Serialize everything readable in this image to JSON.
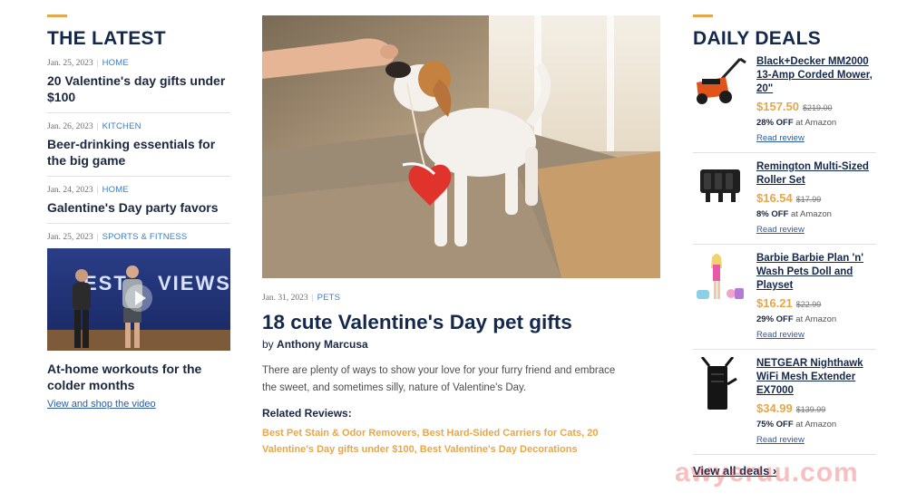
{
  "left": {
    "section_title": "THE LATEST",
    "stories": [
      {
        "date": "Jan. 25, 2023",
        "category": "HOME",
        "title": "20 Valentine's day gifts under $100"
      },
      {
        "date": "Jan. 26, 2023",
        "category": "KITCHEN",
        "title": "Beer-drinking essentials for the big game"
      },
      {
        "date": "Jan. 24, 2023",
        "category": "HOME",
        "title": "Galentine's Day party favors"
      }
    ],
    "video_story": {
      "date": "Jan. 25, 2023",
      "category": "SPORTS & FITNESS",
      "thumb_word_left": "EST",
      "thumb_word_right": "VIEWS",
      "title": "At-home workouts for the colder months",
      "link": "View and shop the video"
    }
  },
  "center": {
    "date": "Jan. 31, 2023",
    "category": "PETS",
    "title": "18 cute Valentine's Day pet gifts",
    "byline_prefix": "by",
    "author": "Anthony Marcusa",
    "summary": "There are plenty of ways to show your love for your furry friend and embrace the sweet, and sometimes silly, nature of Valentine's Day.",
    "related_title": "Related Reviews:",
    "related_links": "Best Pet Stain & Odor Removers, Best Hard-Sided Carriers for Cats, 20 Valentine's Day gifts under $100, Best Valentine's Day Decorations"
  },
  "right": {
    "section_title": "DAILY DEALS",
    "deals": [
      {
        "name": "Black+Decker MM2000 13-Amp Corded Mower, 20\"",
        "price": "$157.50",
        "was": "$219.00",
        "off": "28% OFF",
        "store": "at Amazon",
        "review": "Read review",
        "icon": "lawn-mower"
      },
      {
        "name": "Remington Multi-Sized Roller Set",
        "price": "$16.54",
        "was": "$17.99",
        "off": "8% OFF",
        "store": "at Amazon",
        "review": "Read review",
        "icon": "hair-rollers"
      },
      {
        "name": "Barbie Barbie Plan 'n' Wash Pets Doll and Playset",
        "price": "$16.21",
        "was": "$22.99",
        "off": "29% OFF",
        "store": "at Amazon",
        "review": "Read review",
        "icon": "barbie-doll"
      },
      {
        "name": "NETGEAR Nighthawk WiFi Mesh Extender EX7000",
        "price": "$34.99",
        "was": "$139.99",
        "off": "75% OFF",
        "store": "at Amazon",
        "review": "Read review",
        "icon": "wifi-router"
      }
    ],
    "view_all": "View all deals ›"
  },
  "watermark": "awyeruu.com",
  "colors": {
    "accent": "#e8a64a",
    "navy": "#14284b",
    "link": "#2c5aa8",
    "category": "#3b7dc4"
  }
}
